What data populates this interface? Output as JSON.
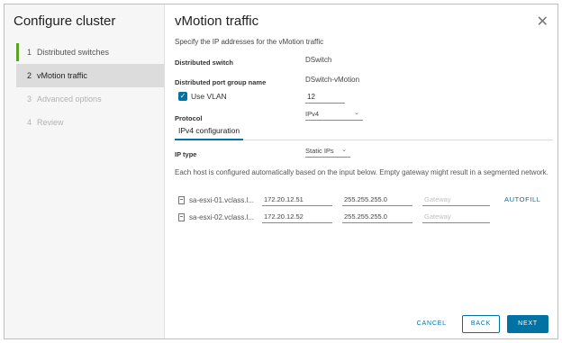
{
  "nav": {
    "title": "Configure cluster",
    "steps": [
      {
        "num": "1",
        "label": "Distributed switches"
      },
      {
        "num": "2",
        "label": "vMotion traffic"
      },
      {
        "num": "3",
        "label": "Advanced options"
      },
      {
        "num": "4",
        "label": "Review"
      }
    ]
  },
  "main": {
    "title": "vMotion traffic",
    "subtitle": "Specify the IP addresses for the vMotion traffic",
    "distributed_switch_label": "Distributed switch",
    "distributed_switch_value": "DSwitch",
    "port_group_label": "Distributed port group name",
    "port_group_value": "DSwitch-vMotion",
    "use_vlan_label": "Use VLAN",
    "vlan_value": "12",
    "protocol_label": "Protocol",
    "protocol_value": "IPv4",
    "tab_label": "IPv4 configuration",
    "ip_type_label": "IP type",
    "ip_type_value": "Static IPs",
    "description": "Each host is configured automatically based on the input below. Empty gateway might result in a segmented network.",
    "hosts": [
      {
        "name": "sa-esxi-01.vclass.l...",
        "ip": "172.20.12.51",
        "mask": "255.255.255.0",
        "gateway_placeholder": "Gateway"
      },
      {
        "name": "sa-esxi-02.vclass.l...",
        "ip": "172.20.12.52",
        "mask": "255.255.255.0",
        "gateway_placeholder": "Gateway"
      }
    ],
    "autofill_label": "AUTOFILL"
  },
  "footer": {
    "cancel": "CANCEL",
    "back": "BACK",
    "next": "NEXT"
  },
  "colors": {
    "accent": "#0072a3",
    "done_step": "#5aa220"
  }
}
